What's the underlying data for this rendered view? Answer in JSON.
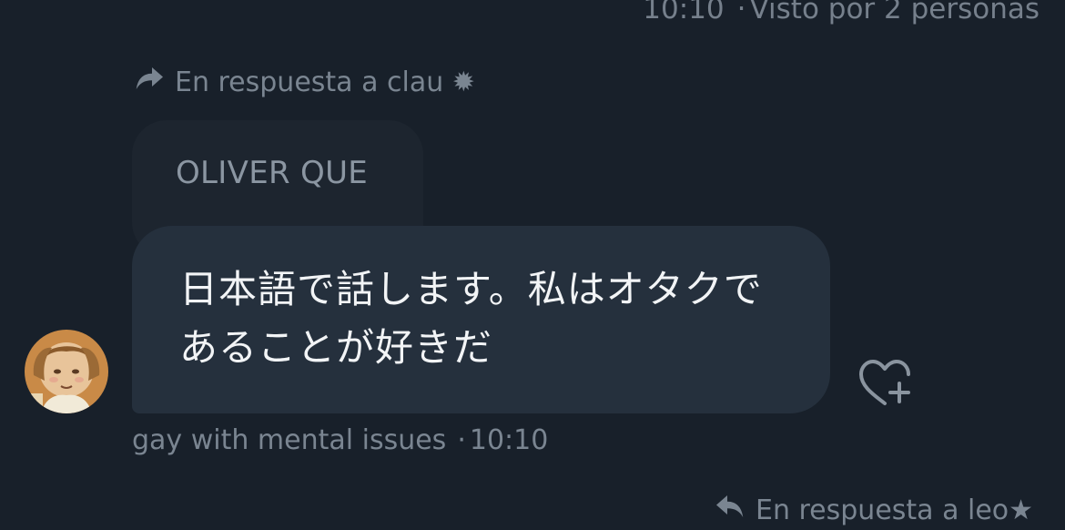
{
  "previous_message": {
    "time": "10:10",
    "seen_label": "Visto por 2 personas"
  },
  "message": {
    "reply_label": "En respuesta a clau ✹",
    "quoted_text": "OLIVER QUE",
    "text": "日本語で話します。私はオタクであることが好きだ",
    "sender": "gay with mental issues",
    "time": "10:10"
  },
  "next_message": {
    "reply_label": "En respuesta a leo★"
  },
  "icons": {
    "reply": "reply-arrow-icon",
    "reaction": "heart-plus-icon",
    "avatar": "avatar"
  },
  "colors": {
    "background": "#18202a",
    "bubble": "#25303d",
    "quoted_bubble": "#1d252f",
    "muted_text": "#7a8591"
  }
}
